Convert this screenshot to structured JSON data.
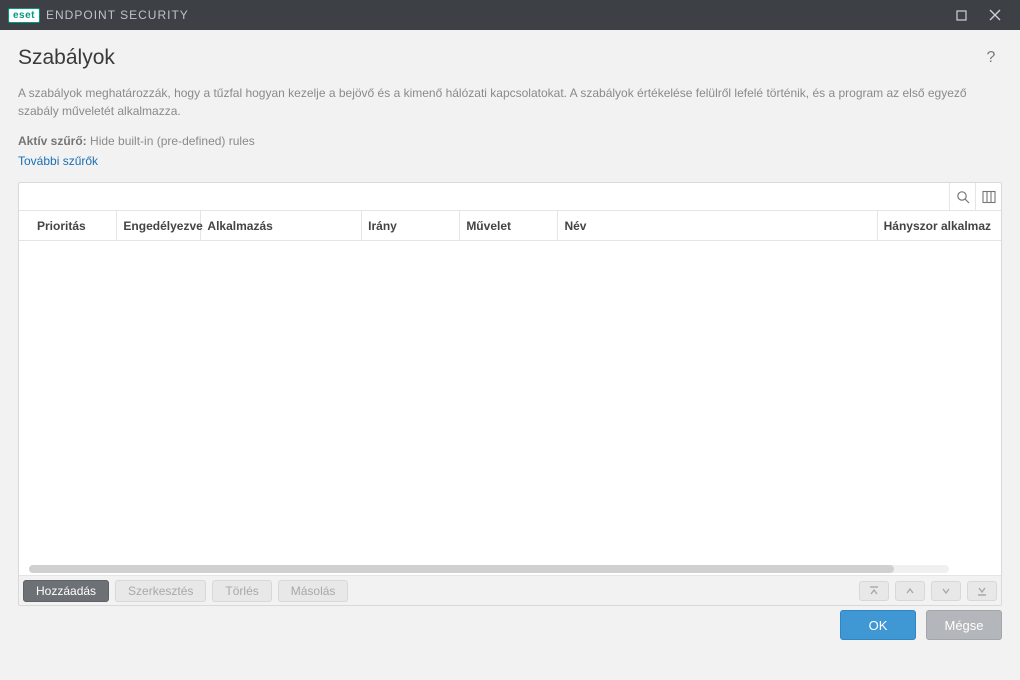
{
  "titlebar": {
    "logo": "eset",
    "product": "ENDPOINT SECURITY"
  },
  "page": {
    "title": "Szabályok",
    "description": "A szabályok meghatározzák, hogy a tűzfal hogyan kezelje a bejövő és a kimenő hálózati kapcsolatokat. A szabályok értékelése felülről lefelé történik, és a program az első egyező szabály műveletét alkalmazza.",
    "active_filter_label": "Aktív szűrő:",
    "active_filter_value": "Hide built-in (pre-defined) rules",
    "more_filters": "További szűrők"
  },
  "table": {
    "columns": {
      "priority": "Prioritás",
      "enabled": "Engedélyezve",
      "application": "Alkalmazás",
      "direction": "Irány",
      "action": "Művelet",
      "name": "Név",
      "times_applied": "Hányszor alkalmaz"
    },
    "rows": []
  },
  "panel_buttons": {
    "add": "Hozzáadás",
    "edit": "Szerkesztés",
    "delete": "Törlés",
    "copy": "Másolás"
  },
  "dialog": {
    "ok": "OK",
    "cancel": "Mégse"
  }
}
